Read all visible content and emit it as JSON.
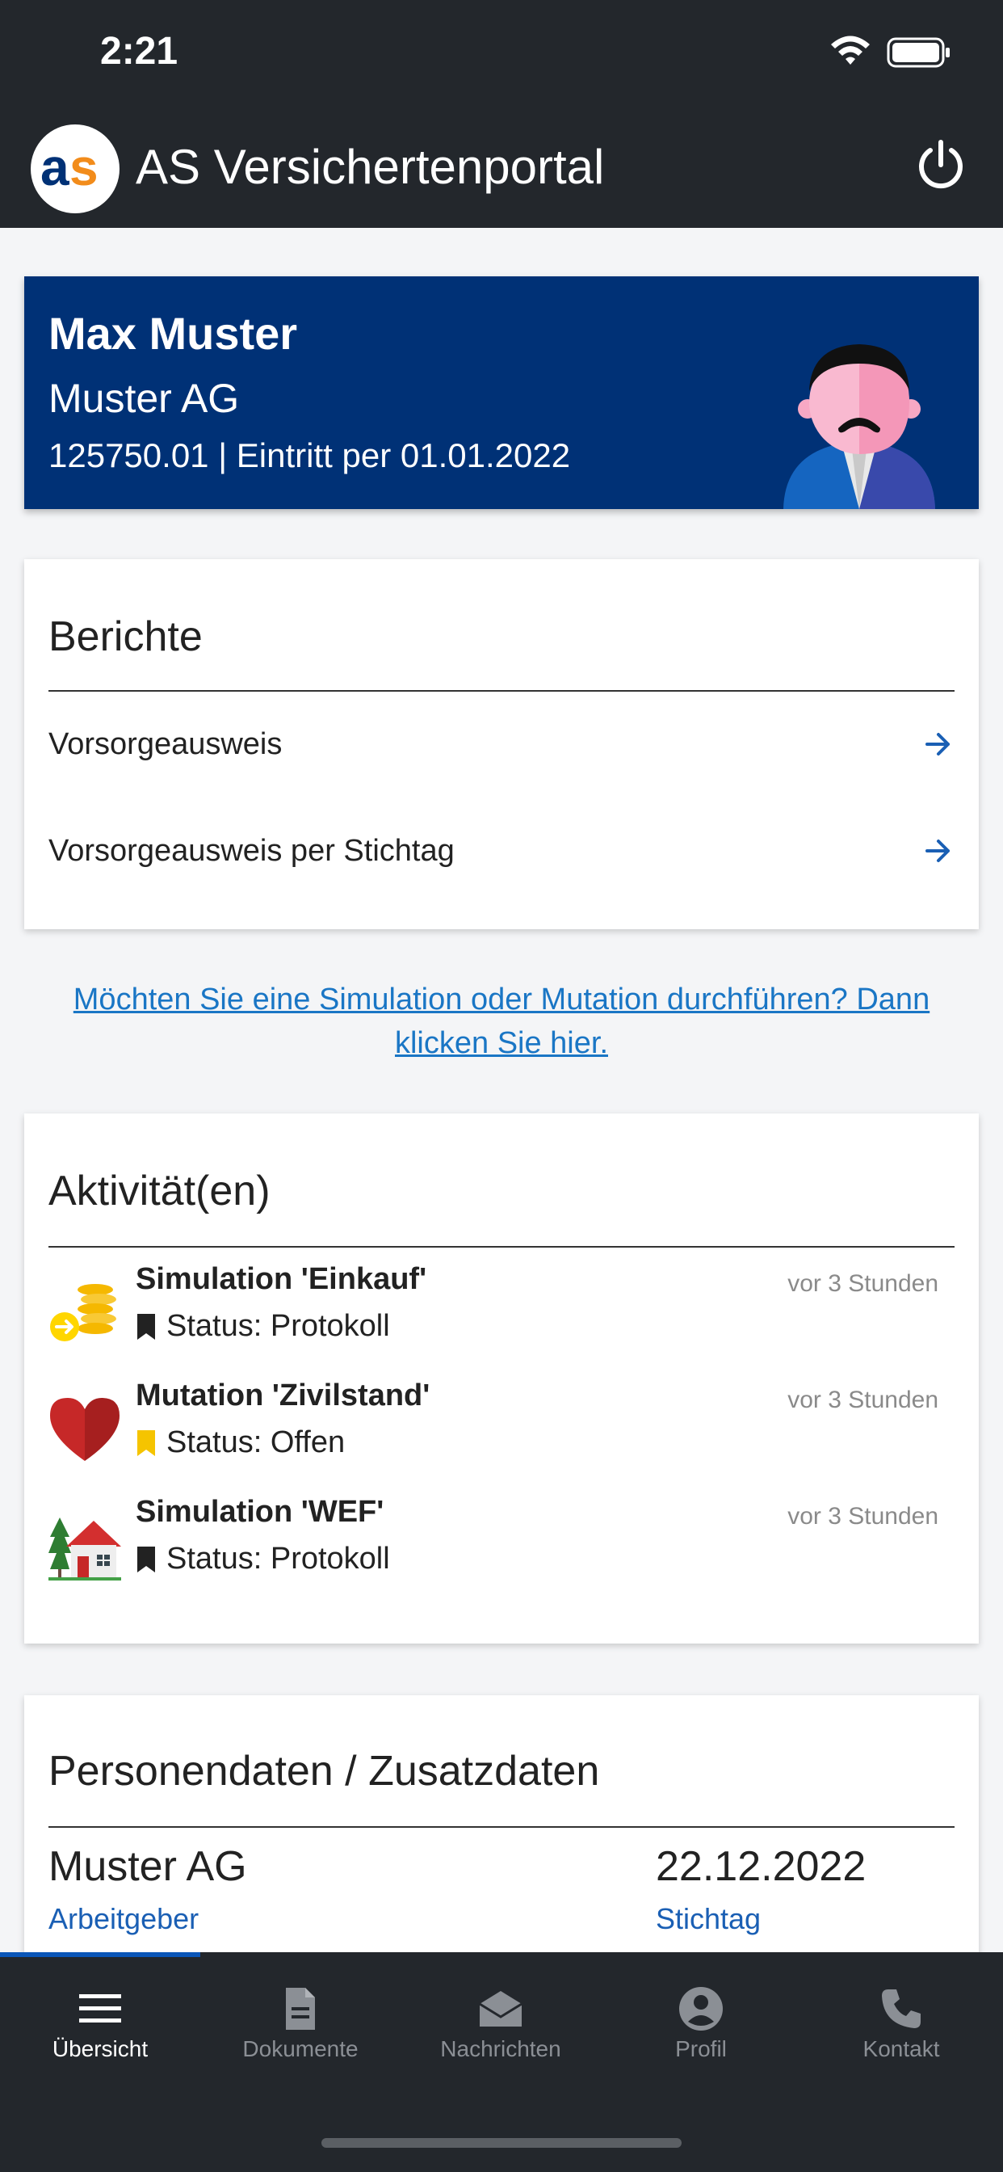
{
  "status_bar": {
    "time": "2:21"
  },
  "header": {
    "logo_text": "as",
    "title": "AS Versichertenportal"
  },
  "profile": {
    "name": "Max Muster",
    "company": "Muster AG",
    "meta": "125750.01 | Eintritt per 01.01.2022"
  },
  "reports": {
    "title": "Berichte",
    "items": [
      {
        "label": "Vorsorgeausweis"
      },
      {
        "label": "Vorsorgeausweis per Stichtag"
      }
    ]
  },
  "cta": {
    "text": "Möchten Sie eine Simulation oder Mutation durchführen? Dann klicken Sie hier."
  },
  "activities": {
    "title": "Aktivität(en)",
    "items": [
      {
        "title": "Simulation 'Einkauf'",
        "status": "Status: Protokoll",
        "time": "vor 3 Stunden",
        "icon": "coins-icon",
        "status_color": "#222222"
      },
      {
        "title": "Mutation 'Zivilstand'",
        "status": "Status: Offen",
        "time": "vor 3 Stunden",
        "icon": "heart-icon",
        "status_color": "#f5c400"
      },
      {
        "title": "Simulation 'WEF'",
        "status": "Status: Protokoll",
        "time": "vor 3 Stunden",
        "icon": "house-icon",
        "status_color": "#222222"
      }
    ]
  },
  "personal": {
    "title": "Personendaten / Zusatzdaten",
    "employer_value": "Muster AG",
    "employer_caption": "Arbeitgeber",
    "date_value": "22.12.2022",
    "date_caption": "Stichtag"
  },
  "nav": {
    "items": [
      {
        "label": "Übersicht",
        "icon": "menu-icon",
        "active": true
      },
      {
        "label": "Dokumente",
        "icon": "document-icon",
        "active": false
      },
      {
        "label": "Nachrichten",
        "icon": "mail-icon",
        "active": false
      },
      {
        "label": "Profil",
        "icon": "profile-icon",
        "active": false
      },
      {
        "label": "Kontakt",
        "icon": "phone-icon",
        "active": false
      }
    ]
  },
  "colors": {
    "header_bg": "#23272c",
    "banner_bg": "#003176",
    "link": "#1a76c5",
    "accent_orange": "#f28c1b",
    "logo_blue": "#003176"
  }
}
